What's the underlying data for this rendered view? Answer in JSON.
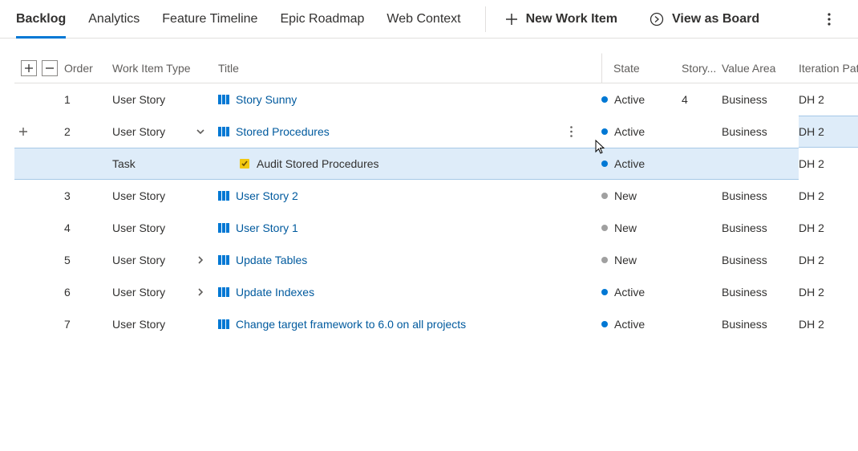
{
  "tabs": {
    "backlog": "Backlog",
    "analytics": "Analytics",
    "featureTimeline": "Feature Timeline",
    "epicRoadmap": "Epic Roadmap",
    "webContext": "Web Context"
  },
  "actions": {
    "newWorkItem": "New Work Item",
    "viewAsBoard": "View as Board"
  },
  "columns": {
    "order": "Order",
    "workItemType": "Work Item Type",
    "title": "Title",
    "state": "State",
    "storyPoints": "Story...",
    "valueArea": "Value Area",
    "iterationPath": "Iteration Path"
  },
  "rows": [
    {
      "order": "1",
      "type": "User Story",
      "title": "Story Sunny",
      "titleKind": "story",
      "expand": "",
      "state": "Active",
      "stateColor": "#0078d4",
      "story": "4",
      "valueArea": "Business",
      "iteration": "DH 2",
      "selected": false,
      "showMore": false,
      "indent": 0
    },
    {
      "order": "2",
      "type": "User Story",
      "title": "Stored Procedures",
      "titleKind": "story",
      "expand": "down",
      "state": "Active",
      "stateColor": "#0078d4",
      "story": "",
      "valueArea": "Business",
      "iteration": "DH 2",
      "selected": true,
      "showMore": true,
      "indent": 0
    },
    {
      "order": "",
      "type": "Task",
      "title": "Audit Stored Procedures",
      "titleKind": "task",
      "expand": "",
      "state": "Active",
      "stateColor": "#0078d4",
      "story": "",
      "valueArea": "",
      "iteration": "DH 2",
      "selected": false,
      "showMore": false,
      "indent": 1
    },
    {
      "order": "3",
      "type": "User Story",
      "title": "User Story 2",
      "titleKind": "story",
      "expand": "",
      "state": "New",
      "stateColor": "#a0a0a0",
      "story": "",
      "valueArea": "Business",
      "iteration": "DH 2",
      "selected": false,
      "showMore": false,
      "indent": 0
    },
    {
      "order": "4",
      "type": "User Story",
      "title": "User Story 1",
      "titleKind": "story",
      "expand": "",
      "state": "New",
      "stateColor": "#a0a0a0",
      "story": "",
      "valueArea": "Business",
      "iteration": "DH 2",
      "selected": false,
      "showMore": false,
      "indent": 0
    },
    {
      "order": "5",
      "type": "User Story",
      "title": "Update Tables",
      "titleKind": "story",
      "expand": "right",
      "state": "New",
      "stateColor": "#a0a0a0",
      "story": "",
      "valueArea": "Business",
      "iteration": "DH 2",
      "selected": false,
      "showMore": false,
      "indent": 0
    },
    {
      "order": "6",
      "type": "User Story",
      "title": "Update Indexes",
      "titleKind": "story",
      "expand": "right",
      "state": "Active",
      "stateColor": "#0078d4",
      "story": "",
      "valueArea": "Business",
      "iteration": "DH 2",
      "selected": false,
      "showMore": false,
      "indent": 0
    },
    {
      "order": "7",
      "type": "User Story",
      "title": "Change target framework to 6.0 on all projects",
      "titleKind": "story",
      "expand": "",
      "state": "Active",
      "stateColor": "#0078d4",
      "story": "",
      "valueArea": "Business",
      "iteration": "DH 2",
      "selected": false,
      "showMore": false,
      "indent": 0
    }
  ]
}
